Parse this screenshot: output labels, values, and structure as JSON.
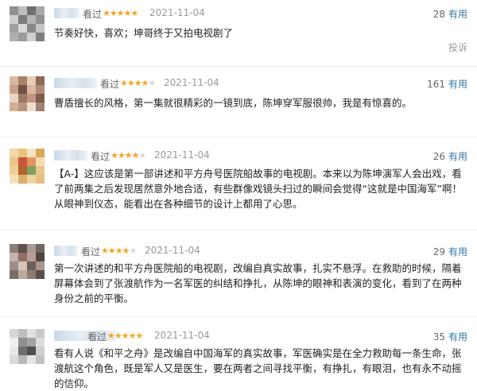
{
  "reviews": [
    {
      "watched_label": "看过",
      "rating": 5,
      "stars_on": "★★★★★",
      "stars_off": "",
      "date": "2021-11-04",
      "useful_count": "28",
      "useful_label": "有用",
      "content": "节奏好快，喜欢；坤哥终于又拍电视剧了",
      "report_label": "投诉"
    },
    {
      "watched_label": "看过",
      "rating": 4,
      "stars_on": "★★★★",
      "stars_off": "★",
      "date": "2021-11-04",
      "useful_count": "161",
      "useful_label": "有用",
      "content": "曹盾擅长的风格，第一集就很精彩的一镜到底，陈坤穿军服很帅，我是有惊喜的。"
    },
    {
      "watched_label": "看过",
      "rating": 4,
      "stars_on": "★★★★",
      "stars_off": "★",
      "date": "2021-11-04",
      "useful_count": "26",
      "useful_label": "有用",
      "content": "【A-】这应该是第一部讲述和平方舟号医院船故事的电视剧。本来以为陈坤演军人会出戏，看了前两集之后发现居然意外地合适，有些群像戏镜头扫过的瞬间会觉得“这就是中国海军”啊！从眼神到仪态，能看出在各种细节的设计上都用了心思。"
    },
    {
      "watched_label": "看过",
      "rating": 4,
      "stars_on": "★★★★",
      "stars_off": "★",
      "date": "2021-11-04",
      "useful_count": "29",
      "useful_label": "有用",
      "content": "第一次讲述的和平方舟医院船的电视剧，改编自真实故事，扎实不悬浮。在救助的时候，隔着屏幕体会到了张渡航作为一名军医的纠结和挣扎，从陈坤的眼神和表演的变化，看到了在两种身份之前的平衡。"
    },
    {
      "watched_label": "看过",
      "rating": 5,
      "stars_on": "★★★★★",
      "stars_off": "",
      "date": "2021-11-04",
      "useful_count": "35",
      "useful_label": "有用",
      "content": "看有人说《和平之舟》是改编自中国海军的真实故事，军医确实是在全力救助每一条生命，张渡航这个角色，既是军人又是医生，要在两者之间寻找平衡，有挣扎，有眼泪，也有永不动摇的信仰。"
    }
  ]
}
